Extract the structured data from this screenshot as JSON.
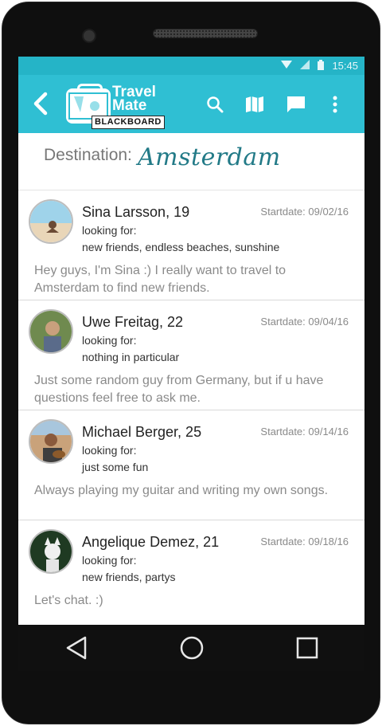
{
  "status_bar": {
    "time": "15:45",
    "icons": [
      "wifi-icon",
      "signal-icon",
      "battery-icon"
    ]
  },
  "app_bar": {
    "logo": {
      "line1": "Travel",
      "line2": "Mate",
      "sub": "BLACKBOARD"
    },
    "actions": [
      "search-icon",
      "map-icon",
      "chat-icon",
      "more-vertical-icon"
    ],
    "color": "#2fbfd3"
  },
  "destination": {
    "label": "Destination:",
    "value": "Amsterdam"
  },
  "posts": [
    {
      "name": "Sina Larsson, 19",
      "startdate": "Startdate: 09/02/16",
      "looking_label": "looking for:",
      "looking": "new friends, endless beaches, sunshine",
      "bio": "Hey guys, I'm Sina :) I really want to travel to Amsterdam to find new friends."
    },
    {
      "name": "Uwe Freitag, 22",
      "startdate": "Startdate: 09/04/16",
      "looking_label": "looking for:",
      "looking": "nothing in particular",
      "bio": "Just some random guy from Germany, but if u have questions feel free to ask me."
    },
    {
      "name": "Michael Berger, 25",
      "startdate": "Startdate: 09/14/16",
      "looking_label": "looking for:",
      "looking": "just some fun",
      "bio": "Always playing my guitar and writing my own songs."
    },
    {
      "name": "Angelique Demez, 21",
      "startdate": "Startdate: 09/18/16",
      "looking_label": "looking for:",
      "looking": "new friends, partys",
      "bio": "Let's chat. :)"
    }
  ],
  "nav": [
    "back-triangle-icon",
    "home-circle-icon",
    "recents-square-icon"
  ]
}
